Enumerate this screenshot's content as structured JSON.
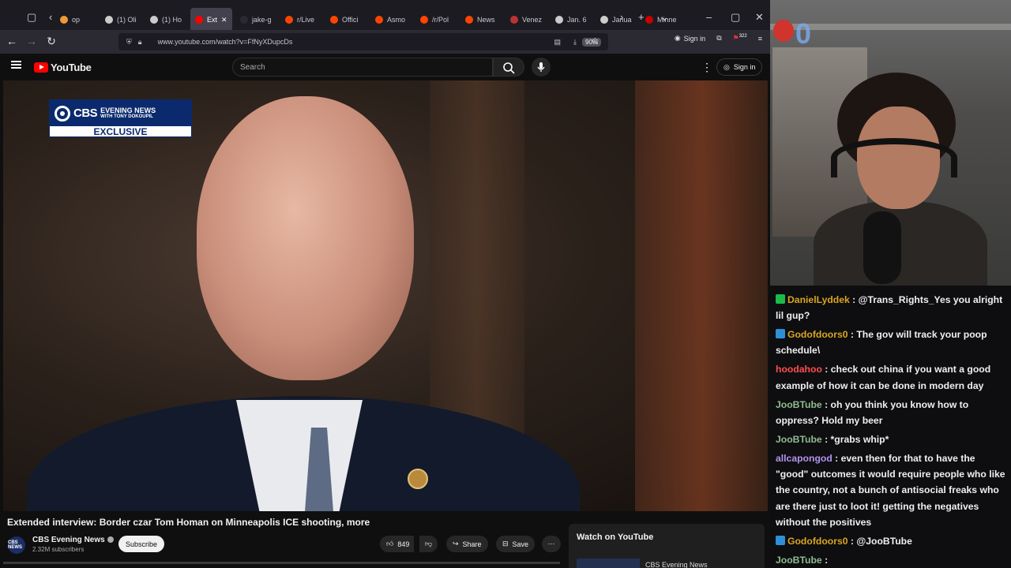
{
  "browser": {
    "tabs": [
      {
        "label": "op",
        "color": "#f09a37"
      },
      {
        "label": "(1) Oli",
        "color": "#cccccc"
      },
      {
        "label": "(1) Ho",
        "color": "#cccccc"
      },
      {
        "label": "Ext",
        "color": "#ff0000",
        "active": true
      },
      {
        "label": "jake-g",
        "color": "#2b2a33"
      },
      {
        "label": "r/Live",
        "color": "#ff4500"
      },
      {
        "label": "Offici",
        "color": "#ff4500"
      },
      {
        "label": "Asmo",
        "color": "#ff4500"
      },
      {
        "label": "/r/Pol",
        "color": "#ff4500"
      },
      {
        "label": "News",
        "color": "#ff4500"
      },
      {
        "label": "Venez",
        "color": "#b33"
      },
      {
        "label": "Jan. 6",
        "color": "#cccccc"
      },
      {
        "label": "Janua",
        "color": "#cccccc"
      },
      {
        "label": "Minne",
        "color": "#cc0000"
      }
    ],
    "url": "www.youtube.com/watch?v=FfNyXDupcDs",
    "zoom": "90%",
    "signin_label": "Sign in",
    "ext_count": "322"
  },
  "youtube": {
    "logo_text": "YouTube",
    "search_placeholder": "Search",
    "signin_label": "Sign in",
    "video": {
      "title": "Extended interview: Border czar Tom Homan on Minneapolis ICE shooting, more",
      "channel": "CBS Evening News",
      "avatar_text": "CBS NEWS",
      "subscribers": "2.32M subscribers",
      "subscribe_label": "Subscribe",
      "likes": "849",
      "share_label": "Share",
      "save_label": "Save",
      "overlay": {
        "logo": "CBS",
        "name": "EVENING NEWS",
        "with": "WITH TONY DOKOUPIL",
        "exclusive": "EXCLUSIVE"
      }
    },
    "watch_on_youtube": "Watch on YouTube",
    "related_channel": "CBS Evening News"
  },
  "webcam": {
    "counter": "0"
  },
  "chat": [
    {
      "user": "DanielLyddek",
      "color": "#daa520",
      "badge": "#1dba4a",
      "text": " : @Trans_Rights_Yes you alright lil gup?"
    },
    {
      "user": "Godofdoors0",
      "color": "#daa520",
      "badge": "#2f8fd6",
      "text": " : The gov will track your poop schedule\\"
    },
    {
      "user": "hoodahoo",
      "color": "#ff4d4d",
      "badge": "",
      "text": " : check out china if you want a good example of how it can be done in modern day"
    },
    {
      "user": "JooBTube",
      "color": "#8fbc8f",
      "badge": "",
      "text": " : oh you think you know how to oppress? Hold my beer"
    },
    {
      "user": "JooBTube",
      "color": "#8fbc8f",
      "badge": "",
      "text": " : *grabs whip*"
    },
    {
      "user": "allcapongod",
      "color": "#b392f0",
      "badge": "",
      "text": " : even then for that to have the \"good\" outcomes it would require people who like the country, not a bunch of antisocial freaks who are there just to loot it! getting the negatives without the positives"
    },
    {
      "user": "Godofdoors0",
      "color": "#daa520",
      "badge": "#2f8fd6",
      "text": " : @JooBTube"
    },
    {
      "user": "JooBTube",
      "color": "#8fbc8f",
      "badge": "",
      "text": " :"
    }
  ]
}
